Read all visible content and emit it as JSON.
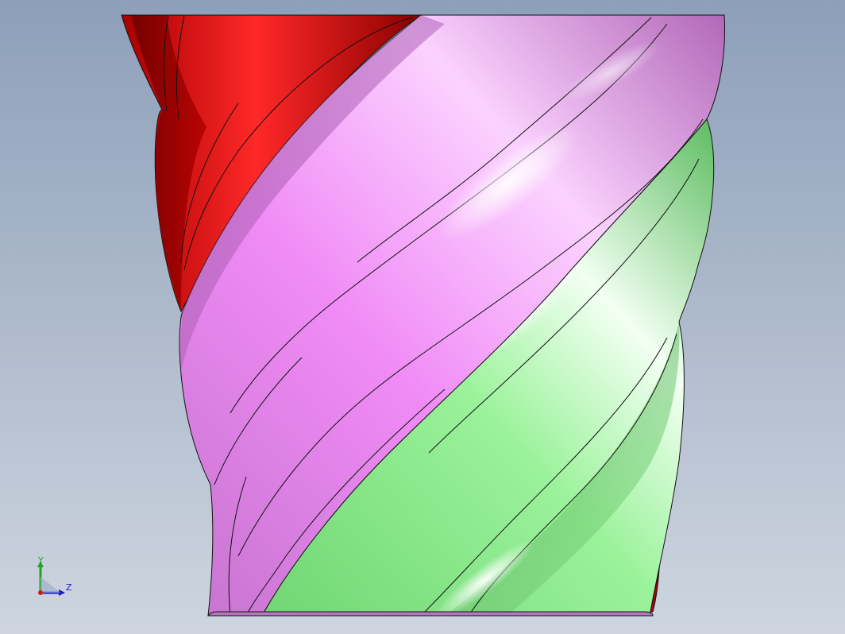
{
  "viewport": {
    "background_top": "#8d9fb9",
    "background_bottom": "#ced5df",
    "edge_color": "#111111"
  },
  "model": {
    "part_colors": {
      "red": "#e01010",
      "red_dark": "#9a0000",
      "red_light": "#ff3a3a",
      "magenta": "#e580ee",
      "magenta_dark": "#a45aa9",
      "magenta_light": "#fbc9ff",
      "green": "#8ceb8c",
      "green_dark": "#4aa64f",
      "green_light": "#e6ffe6"
    }
  },
  "triad": {
    "y_label": "Y",
    "z_label": "Z",
    "y_color": "#1fa51f",
    "z_color": "#1b1bd0",
    "x_color": "#d01b1b"
  }
}
